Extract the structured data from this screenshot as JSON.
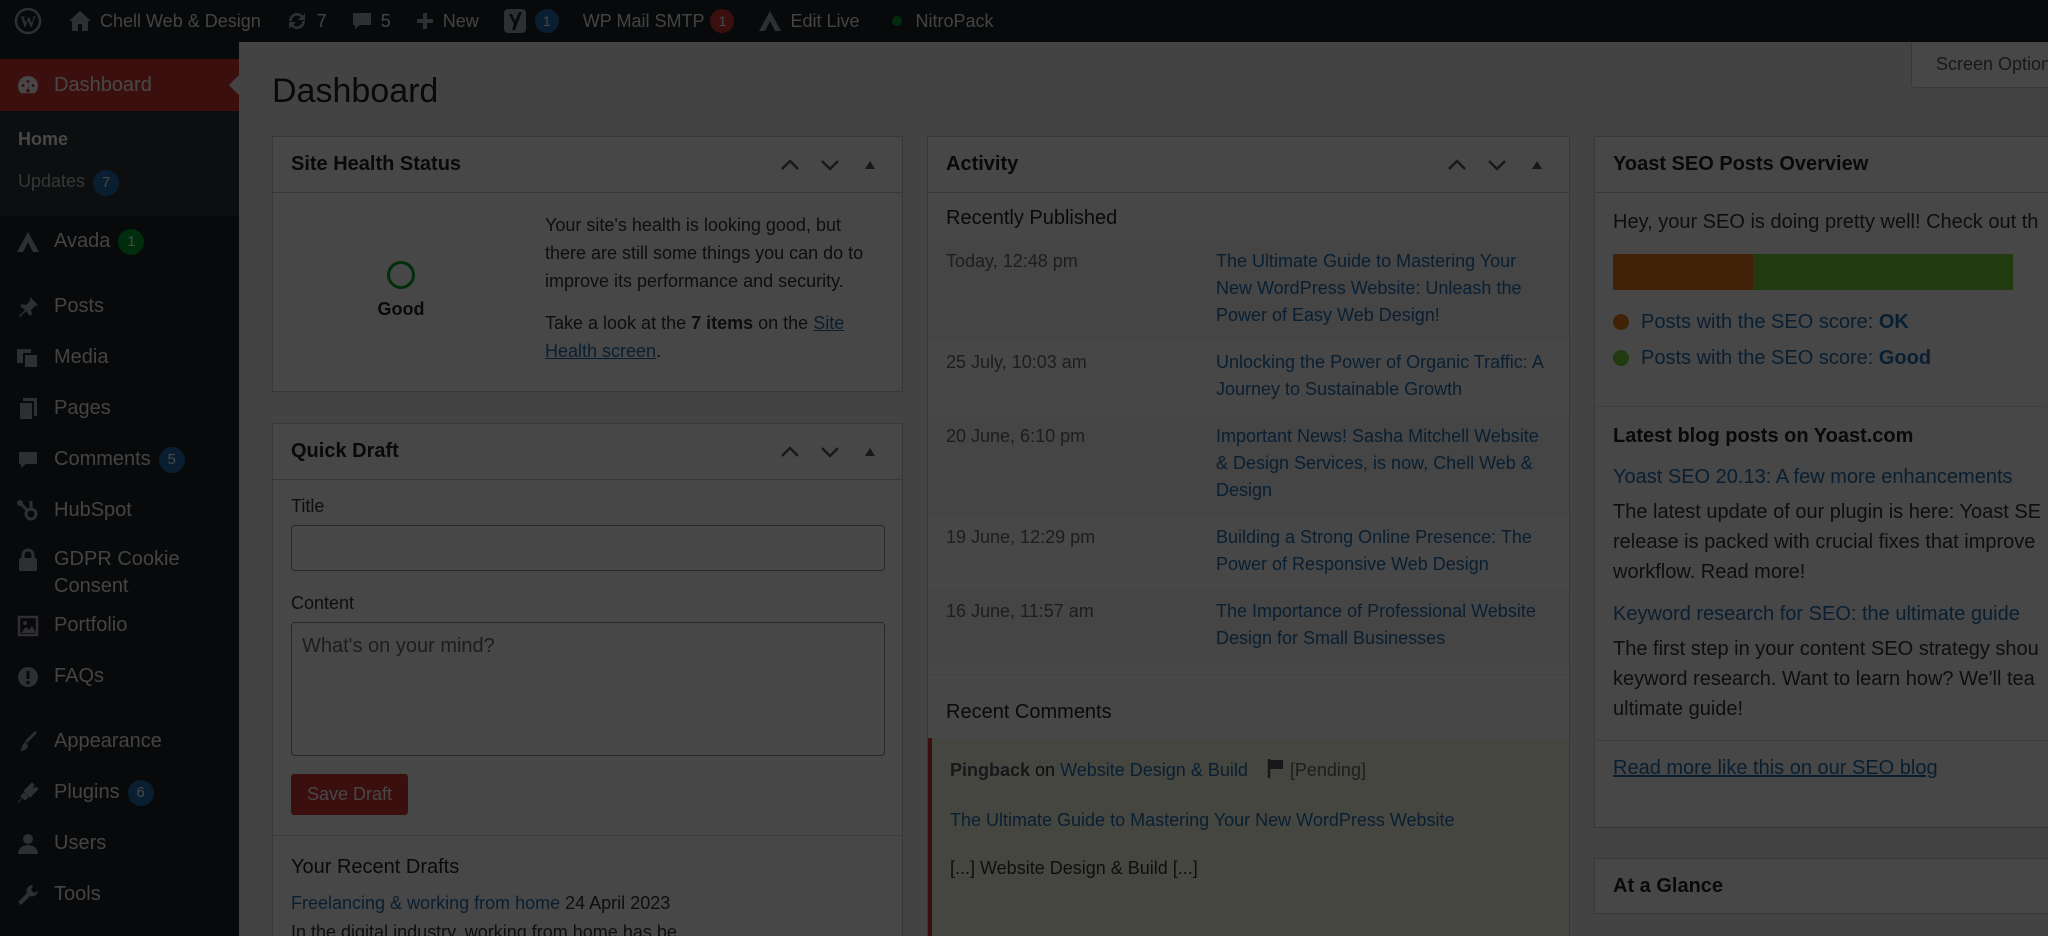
{
  "adminbar": {
    "site_name": "Chell Web & Design",
    "updates_count": "7",
    "comments_count": "5",
    "new_label": "New",
    "yoast_count": "1",
    "smtp_label": "WP Mail SMTP",
    "smtp_count": "1",
    "edit_live_label": "Edit Live",
    "nitropack_label": "NitroPack"
  },
  "sidebar": {
    "dashboard": "Dashboard",
    "home": "Home",
    "updates": "Updates",
    "updates_count": "7",
    "avada": "Avada",
    "avada_count": "1",
    "posts": "Posts",
    "media": "Media",
    "pages": "Pages",
    "comments": "Comments",
    "comments_count": "5",
    "hubspot": "HubSpot",
    "gdpr_line1": "GDPR Cookie",
    "gdpr_line2": "Consent",
    "portfolio": "Portfolio",
    "faqs": "FAQs",
    "appearance": "Appearance",
    "plugins": "Plugins",
    "plugins_count": "6",
    "users": "Users",
    "tools": "Tools"
  },
  "screen_options": "Screen Options",
  "page_title": "Dashboard",
  "site_health": {
    "title": "Site Health Status",
    "status": "Good",
    "message": "Your site's health is looking good, but there are still some things you can do to improve its performance and security.",
    "take_look_prefix": "Take a look at the ",
    "items": "7 items",
    "on_the": " on the ",
    "link": "Site Health screen",
    "period": "."
  },
  "quick_draft": {
    "title": "Quick Draft",
    "title_label": "Title",
    "content_label": "Content",
    "content_placeholder": "What's on your mind?",
    "save_label": "Save Draft",
    "recent_drafts_heading": "Your Recent Drafts",
    "draft_title": "Freelancing & working from home",
    "draft_date": "24 April 2023",
    "draft_excerpt": "In the digital industry, working from home has be"
  },
  "activity": {
    "title": "Activity",
    "recently_published": "Recently Published",
    "posts": [
      {
        "date": "Today, 12:48 pm",
        "title": "The Ultimate Guide to Mastering Your New WordPress Website: Unleash the Power of Easy Web Design!"
      },
      {
        "date": "25 July, 10:03 am",
        "title": "Unlocking the Power of Organic Traffic: A Journey to Sustainable Growth"
      },
      {
        "date": "20 June, 6:10 pm",
        "title": "Important News! Sasha Mitchell Website & Design Services, is now, Chell Web & Design"
      },
      {
        "date": "19 June, 12:29 pm",
        "title": "Building a Strong Online Presence: The Power of Responsive Web Design"
      },
      {
        "date": "16 June, 11:57 am",
        "title": "The Importance of Professional Website Design for Small Businesses"
      }
    ],
    "recent_comments": "Recent Comments",
    "comment": {
      "type": "Pingback",
      "on": "on",
      "post": "Website Design & Build",
      "status": "[Pending]",
      "link": "The Ultimate Guide to Mastering Your New WordPress Website",
      "excerpt": "[...] Website Design & Build [...]"
    }
  },
  "yoast": {
    "title": "Yoast SEO Posts Overview",
    "intro": "Hey, your SEO is doing pretty well! Check out th",
    "ok_fraction": 0.35,
    "legend_prefix": "Posts with the SEO score: ",
    "ok_label": "OK",
    "good_label": "Good",
    "ok_color": "#ee7c1b",
    "good_color": "#7ad03a",
    "blog_heading": "Latest blog posts on Yoast.com",
    "post1_title": "Yoast SEO 20.13: A few more enhancements",
    "post1_desc_line1": "The latest update of our plugin is here: Yoast SE",
    "post1_desc_line2": "release is packed with crucial fixes that improve",
    "post1_desc_line3": "workflow. Read more!",
    "post2_title": "Keyword research for SEO: the ultimate guide",
    "post2_desc_line1": "The first step in your content SEO strategy shou",
    "post2_desc_line2": "keyword research. Want to learn how? We'll tea",
    "post2_desc_line3": "ultimate guide!",
    "read_more": "Read more like this on our SEO blog"
  },
  "at_a_glance": {
    "title": "At a Glance"
  }
}
